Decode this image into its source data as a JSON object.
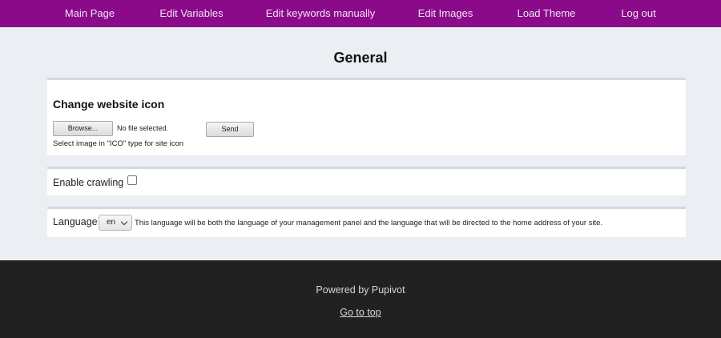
{
  "nav": {
    "items": [
      {
        "label": "Main Page"
      },
      {
        "label": "Edit Variables"
      },
      {
        "label": "Edit keywords manually"
      },
      {
        "label": "Edit Images"
      },
      {
        "label": "Load Theme"
      },
      {
        "label": "Log out"
      }
    ]
  },
  "page": {
    "title": "General"
  },
  "icon_section": {
    "heading": "Change website icon",
    "browse_label": "Browse...",
    "file_status": "No file selected.",
    "send_label": "Send",
    "hint": "Select image in \"ICO\" type for site icon"
  },
  "crawl_section": {
    "label": "Enable crawling",
    "checked": false
  },
  "language_section": {
    "label": "Language",
    "selected": "en",
    "description": "This language will be both the language of your management panel and the language that will be directed to the home address of your site."
  },
  "footer": {
    "powered": "Powered by Pupivot",
    "go_top": "Go to top"
  },
  "colors": {
    "nav_bg": "#8a0a8a",
    "page_bg": "#ebeef3",
    "footer_bg": "#212121"
  }
}
